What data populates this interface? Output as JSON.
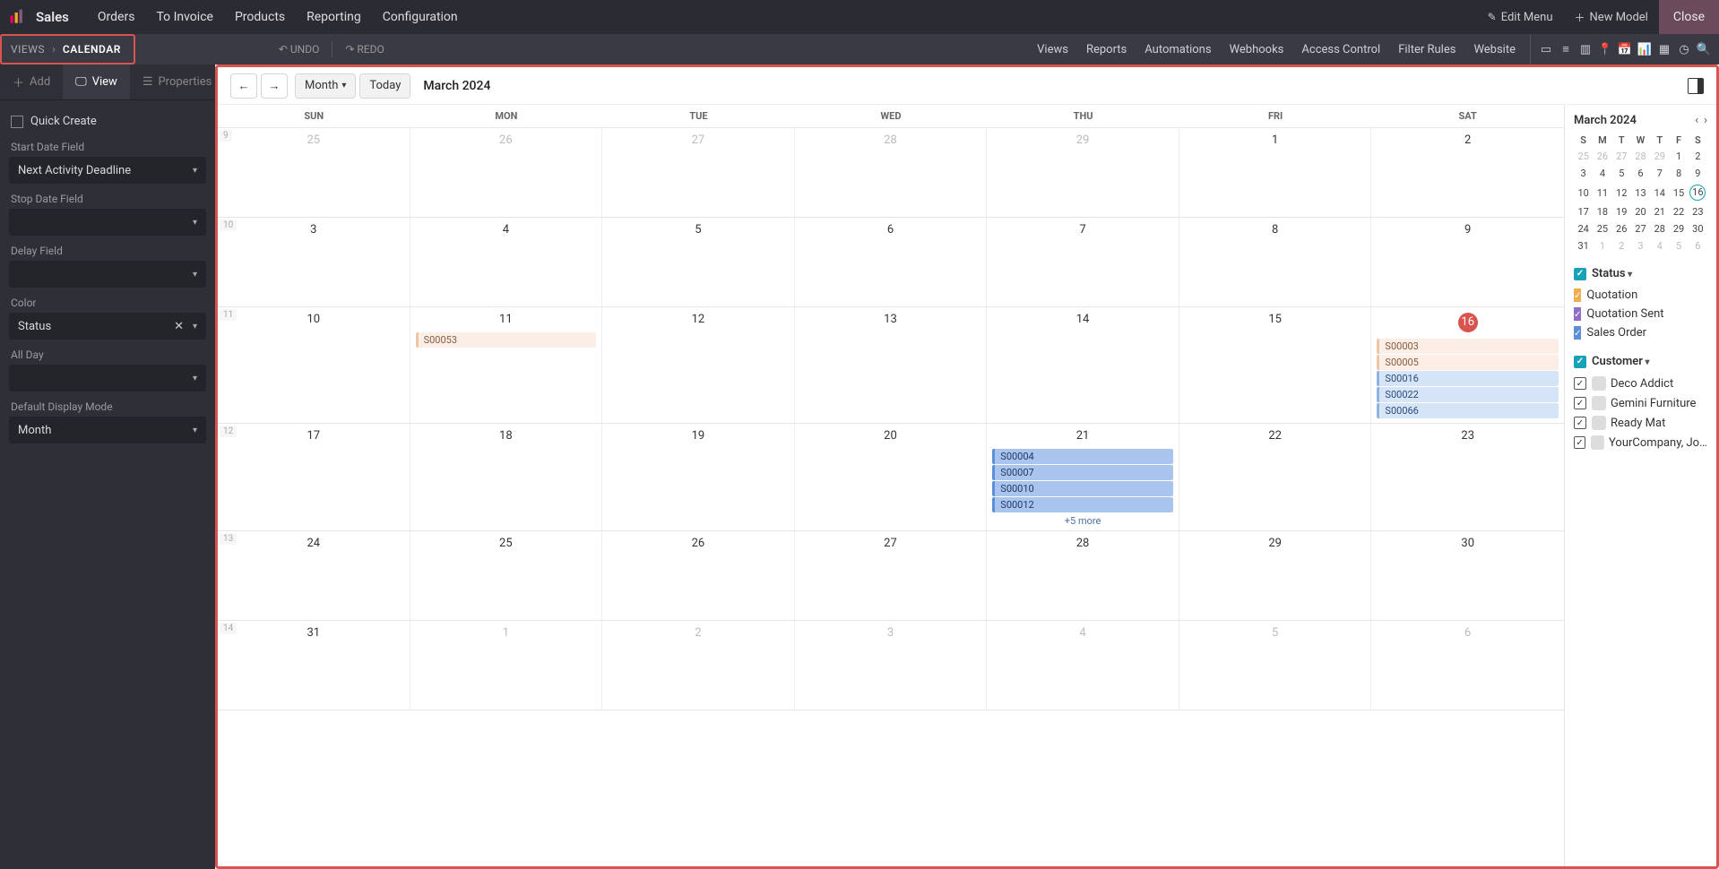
{
  "topbar": {
    "app_name": "Sales",
    "menu": [
      "Orders",
      "To Invoice",
      "Products",
      "Reporting",
      "Configuration"
    ],
    "edit_menu": "Edit Menu",
    "new_model": "New Model",
    "close": "Close"
  },
  "secondbar": {
    "crumb_root": "VIEWS",
    "crumb_current": "CALENDAR",
    "undo": "UNDO",
    "redo": "REDO",
    "nav": [
      "Views",
      "Reports",
      "Automations",
      "Webhooks",
      "Access Control",
      "Filter Rules",
      "Website"
    ]
  },
  "sidebar": {
    "tabs": {
      "add": "Add",
      "view": "View",
      "properties": "Properties"
    },
    "quick_create": "Quick Create",
    "labels": {
      "start_date": "Start Date Field",
      "stop_date": "Stop Date Field",
      "delay": "Delay Field",
      "color": "Color",
      "all_day": "All Day",
      "default_mode": "Default Display Mode"
    },
    "values": {
      "start_date": "Next Activity Deadline",
      "stop_date": "",
      "delay": "",
      "color": "Status",
      "all_day": "",
      "default_mode": "Month"
    }
  },
  "calendar": {
    "toolbar": {
      "month_btn": "Month",
      "today": "Today",
      "title": "March 2024"
    },
    "dow": [
      "SUN",
      "MON",
      "TUE",
      "WED",
      "THU",
      "FRI",
      "SAT"
    ],
    "weeks": [
      {
        "num": "9",
        "days": [
          {
            "n": "25",
            "other": true
          },
          {
            "n": "26",
            "other": true
          },
          {
            "n": "27",
            "other": true
          },
          {
            "n": "28",
            "other": true
          },
          {
            "n": "29",
            "other": true
          },
          {
            "n": "1"
          },
          {
            "n": "2"
          }
        ]
      },
      {
        "num": "10",
        "days": [
          {
            "n": "3"
          },
          {
            "n": "4"
          },
          {
            "n": "5"
          },
          {
            "n": "6"
          },
          {
            "n": "7"
          },
          {
            "n": "8"
          },
          {
            "n": "9"
          }
        ]
      },
      {
        "num": "11",
        "days": [
          {
            "n": "10"
          },
          {
            "n": "11",
            "events": [
              {
                "t": "S00053",
                "c": "ev-orange-light"
              }
            ]
          },
          {
            "n": "12"
          },
          {
            "n": "13"
          },
          {
            "n": "14"
          },
          {
            "n": "15"
          },
          {
            "n": "16",
            "today": true,
            "events": [
              {
                "t": "S00003",
                "c": "ev-orange-light"
              },
              {
                "t": "S00005",
                "c": "ev-orange-light"
              },
              {
                "t": "S00016",
                "c": "ev-blue"
              },
              {
                "t": "S00022",
                "c": "ev-blue"
              },
              {
                "t": "S00066",
                "c": "ev-blue"
              }
            ]
          }
        ]
      },
      {
        "num": "12",
        "days": [
          {
            "n": "17"
          },
          {
            "n": "18"
          },
          {
            "n": "19"
          },
          {
            "n": "20"
          },
          {
            "n": "21",
            "events": [
              {
                "t": "S00004",
                "c": "ev-blue-solid"
              },
              {
                "t": "S00007",
                "c": "ev-blue-solid"
              },
              {
                "t": "S00010",
                "c": "ev-blue-solid"
              },
              {
                "t": "S00012",
                "c": "ev-blue-solid"
              }
            ],
            "more": "+5 more"
          },
          {
            "n": "22"
          },
          {
            "n": "23"
          }
        ]
      },
      {
        "num": "13",
        "days": [
          {
            "n": "24"
          },
          {
            "n": "25"
          },
          {
            "n": "26"
          },
          {
            "n": "27"
          },
          {
            "n": "28"
          },
          {
            "n": "29"
          },
          {
            "n": "30"
          }
        ]
      },
      {
        "num": "14",
        "days": [
          {
            "n": "31"
          },
          {
            "n": "1",
            "other": true
          },
          {
            "n": "2",
            "other": true
          },
          {
            "n": "3",
            "other": true
          },
          {
            "n": "4",
            "other": true
          },
          {
            "n": "5",
            "other": true
          },
          {
            "n": "6",
            "other": true
          }
        ]
      }
    ]
  },
  "rpanel": {
    "mini_title": "March 2024",
    "mini_dow": [
      "S",
      "M",
      "T",
      "W",
      "T",
      "F",
      "S"
    ],
    "mini_weeks": [
      [
        {
          "n": "25",
          "o": true
        },
        {
          "n": "26",
          "o": true
        },
        {
          "n": "27",
          "o": true
        },
        {
          "n": "28",
          "o": true
        },
        {
          "n": "29",
          "o": true
        },
        {
          "n": "1"
        },
        {
          "n": "2"
        }
      ],
      [
        {
          "n": "3"
        },
        {
          "n": "4"
        },
        {
          "n": "5"
        },
        {
          "n": "6"
        },
        {
          "n": "7"
        },
        {
          "n": "8"
        },
        {
          "n": "9"
        }
      ],
      [
        {
          "n": "10"
        },
        {
          "n": "11"
        },
        {
          "n": "12"
        },
        {
          "n": "13"
        },
        {
          "n": "14"
        },
        {
          "n": "15"
        },
        {
          "n": "16",
          "t": true
        }
      ],
      [
        {
          "n": "17"
        },
        {
          "n": "18"
        },
        {
          "n": "19"
        },
        {
          "n": "20"
        },
        {
          "n": "21"
        },
        {
          "n": "22"
        },
        {
          "n": "23"
        }
      ],
      [
        {
          "n": "24"
        },
        {
          "n": "25"
        },
        {
          "n": "26"
        },
        {
          "n": "27"
        },
        {
          "n": "28"
        },
        {
          "n": "29"
        },
        {
          "n": "30"
        }
      ],
      [
        {
          "n": "31"
        },
        {
          "n": "1",
          "o": true
        },
        {
          "n": "2",
          "o": true
        },
        {
          "n": "3",
          "o": true
        },
        {
          "n": "4",
          "o": true
        },
        {
          "n": "5",
          "o": true
        },
        {
          "n": "6",
          "o": true
        }
      ]
    ],
    "status_title": "Status",
    "status_items": [
      {
        "c": "sq-orange",
        "label": "Quotation"
      },
      {
        "c": "sq-purple",
        "label": "Quotation Sent"
      },
      {
        "c": "sq-blue",
        "label": "Sales Order"
      }
    ],
    "customer_title": "Customer",
    "customer_items": [
      {
        "a": "av1",
        "label": "Deco Addict"
      },
      {
        "a": "av2",
        "label": "Gemini Furniture"
      },
      {
        "a": "av3",
        "label": "Ready Mat"
      },
      {
        "a": "av4",
        "label": "YourCompany, Joe..."
      }
    ]
  }
}
